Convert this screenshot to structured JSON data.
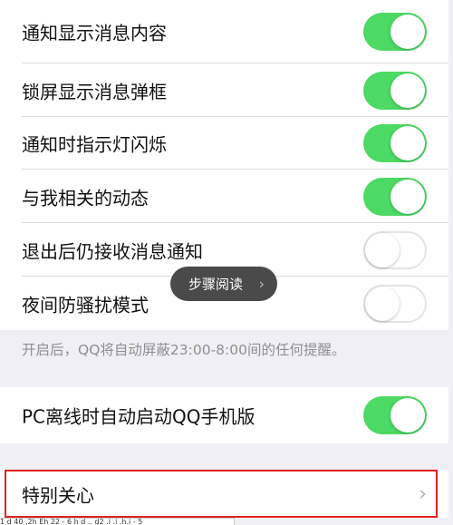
{
  "settings": [
    {
      "label": "通知显示消息内容",
      "state": "on"
    },
    {
      "label": "锁屏显示消息弹框",
      "state": "on"
    },
    {
      "label": "通知时指示灯闪烁",
      "state": "on"
    },
    {
      "label": "与我相关的动态",
      "state": "on"
    },
    {
      "label": "退出后仍接收消息通知",
      "state": "off"
    },
    {
      "label": "夜间防骚扰模式",
      "state": "off"
    }
  ],
  "night_mode_note": "开启后，QQ将自动屏蔽23:00-8:00间的任何提醒。",
  "pc_offline": {
    "label": "PC离线时自动启动QQ手机版",
    "state": "on"
  },
  "special_care": {
    "label": "特别关心"
  },
  "tooltip": {
    "label": "步骤阅读"
  },
  "bottom_text": "1 d 40 ,2h Eh 22 - 6 h d .. d2 .i .i .h.i - 5",
  "colors": {
    "toggle_on": "#4cd964",
    "highlight": "#e02020",
    "background": "#efeff4"
  },
  "icons": {
    "tooltip_chevron": "chevron-right-icon",
    "row_chevron": "chevron-right-icon"
  }
}
